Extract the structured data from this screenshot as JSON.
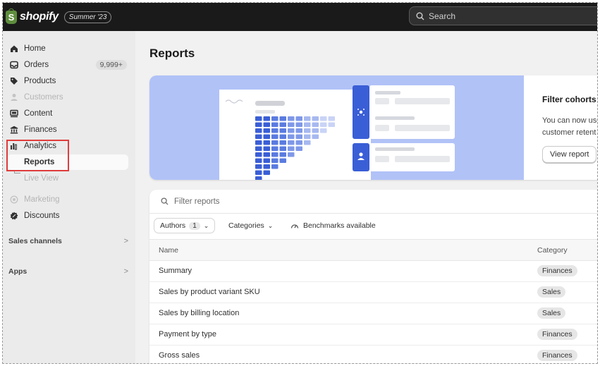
{
  "topbar": {
    "logo_text": "shopify",
    "logo_glyph": "S",
    "version_badge": "Summer '23",
    "search_placeholder": "Search"
  },
  "sidebar": {
    "items": [
      {
        "label": "Home",
        "icon": "home-icon",
        "state": "normal"
      },
      {
        "label": "Orders",
        "icon": "inbox-icon",
        "state": "normal",
        "badge": "9,999+"
      },
      {
        "label": "Products",
        "icon": "tag-icon",
        "state": "normal"
      },
      {
        "label": "Customers",
        "icon": "person-icon",
        "state": "disabled"
      },
      {
        "label": "Content",
        "icon": "content-icon",
        "state": "normal"
      },
      {
        "label": "Finances",
        "icon": "bank-icon",
        "state": "normal"
      },
      {
        "label": "Analytics",
        "icon": "bar-chart-icon",
        "state": "normal"
      },
      {
        "label": "Reports",
        "icon": "",
        "state": "selected"
      },
      {
        "label": "Live View",
        "icon": "",
        "state": "disabled"
      },
      {
        "label": "Marketing",
        "icon": "target-icon",
        "state": "disabled"
      },
      {
        "label": "Discounts",
        "icon": "discount-icon",
        "state": "normal"
      }
    ],
    "sections": [
      {
        "label": "Sales channels",
        "chevron": ">"
      },
      {
        "label": "Apps",
        "chevron": ">"
      }
    ]
  },
  "main": {
    "title": "Reports",
    "banner": {
      "title": "Filter cohorts b",
      "text_line1": "You can now use",
      "text_line2": "customer retent",
      "button_label": "View report"
    },
    "filter_placeholder": "Filter reports",
    "chips": {
      "authors_label": "Authors",
      "authors_count": "1",
      "categories_label": "Categories",
      "benchmarks_label": "Benchmarks available"
    },
    "table": {
      "headers": [
        "Name",
        "Category"
      ],
      "rows": [
        {
          "name": "Summary",
          "category": "Finances"
        },
        {
          "name": "Sales by product variant SKU",
          "category": "Sales"
        },
        {
          "name": "Sales by billing location",
          "category": "Sales"
        },
        {
          "name": "Payment by type",
          "category": "Finances"
        },
        {
          "name": "Gross sales",
          "category": "Finances"
        }
      ]
    }
  },
  "colors": {
    "topbar": "#1a1a1a",
    "sidebar": "#ebebeb",
    "banner_bg": "#b1c2f7",
    "accent_blue": "#3a5ed6",
    "highlight_red": "#e03c3c"
  }
}
